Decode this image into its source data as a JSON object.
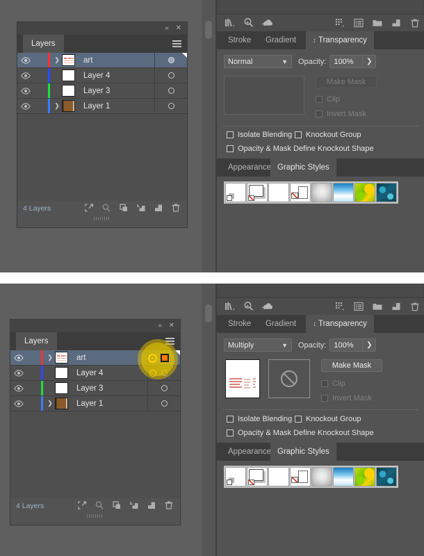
{
  "app": {
    "background_color": "#5f5f5f",
    "panel_bg": "#535353"
  },
  "top": {
    "layers_panel": {
      "title": "Layers",
      "collapse_label": "«",
      "close_label": "✕",
      "menu_icon": "hamburger-menu-icon",
      "columns": [
        "visibility",
        "lock",
        "color",
        "expand",
        "thumbnail",
        "name",
        "target"
      ],
      "rows": [
        {
          "name": "art",
          "visible": true,
          "selected": true,
          "color": "#ff2e2e",
          "has_disclosure": true,
          "thumb_type": "art",
          "target_filled": true
        },
        {
          "name": "Layer 4",
          "visible": true,
          "selected": false,
          "color": "#2b49ff",
          "has_disclosure": false,
          "thumb_type": "blank",
          "target_filled": false
        },
        {
          "name": "Layer 3",
          "visible": true,
          "selected": false,
          "color": "#1fe03c",
          "has_disclosure": false,
          "thumb_type": "blank",
          "target_filled": false
        },
        {
          "name": "Layer 1",
          "visible": true,
          "selected": false,
          "color": "#3a7bff",
          "has_disclosure": true,
          "thumb_type": "brown",
          "target_filled": false
        }
      ],
      "footer": {
        "count_label": "4 Layers",
        "buttons": [
          "locate-object-icon",
          "search-icon",
          "make-clipping-mask-icon",
          "create-new-sublayer-icon",
          "create-new-layer-icon",
          "delete-selection-icon"
        ]
      }
    },
    "right_panel": {
      "toolbar_icons_left": [
        "libraries-icon",
        "stock-search-icon",
        "cloud-upload-icon"
      ],
      "toolbar_icons_right": [
        "arrange-grid-icon",
        "properties-list-icon",
        "folder-icon",
        "new-layer-icon",
        "trash-icon"
      ],
      "tabs": [
        {
          "label": "Stroke",
          "active": false
        },
        {
          "label": "Gradient",
          "active": false
        },
        {
          "label": "Transparency",
          "active": true,
          "grip": "↕"
        }
      ],
      "blend_mode": "Normal",
      "opacity_label": "Opacity:",
      "opacity_value": "100%",
      "opacity_stepper_icon": "chevron-right-icon",
      "make_mask_label": "Make Mask",
      "clip_label": "Clip",
      "invert_mask_label": "Invert Mask",
      "clip_checked": false,
      "invert_checked": false,
      "isolate_blending_label": "Isolate Blending",
      "knockout_group_label": "Knockout Group",
      "opacity_mask_label": "Opacity & Mask Define Knockout Shape",
      "isolate_checked": false,
      "knockout_checked": false,
      "opacity_mask_checked": false,
      "artwork_thumb_visible": false,
      "mask_thumb_visible": false,
      "styles_tabs": [
        {
          "label": "Appearance",
          "active": false
        },
        {
          "label": "Graphic Styles",
          "active": true
        }
      ],
      "graphic_styles": [
        {
          "name": "default-drop-shadow-style",
          "kind": "white-with-shadow"
        },
        {
          "name": "none-style",
          "kind": "white-slash"
        },
        {
          "name": "plain-white-style",
          "kind": "white"
        },
        {
          "name": "split-none-style",
          "kind": "split-slash"
        },
        {
          "name": "grey-gradient-style",
          "kind": "grey-grad"
        },
        {
          "name": "blue-gradient-style",
          "kind": "blue-grad"
        },
        {
          "name": "green-yellow-pattern-style",
          "kind": "green-pattern"
        },
        {
          "name": "teal-swirl-pattern-style",
          "kind": "teal-pattern"
        }
      ]
    }
  },
  "bottom": {
    "layers_panel": {
      "title": "Layers",
      "collapse_label": "«",
      "close_label": "✕",
      "menu_icon": "hamburger-menu-icon",
      "rows": [
        {
          "name": "art",
          "visible": true,
          "selected": true,
          "color": "#ff2e2e",
          "has_disclosure": true,
          "thumb_type": "art",
          "target_filled": true
        },
        {
          "name": "Layer 4",
          "visible": true,
          "selected": false,
          "color": "#2b49ff",
          "has_disclosure": false,
          "thumb_type": "blank",
          "target_filled": false
        },
        {
          "name": "Layer 3",
          "visible": true,
          "selected": false,
          "color": "#1fe03c",
          "has_disclosure": false,
          "thumb_type": "blank",
          "target_filled": false
        },
        {
          "name": "Layer 1",
          "visible": true,
          "selected": false,
          "color": "#3a7bff",
          "has_disclosure": true,
          "thumb_type": "brown",
          "target_filled": false
        }
      ],
      "footer": {
        "count_label": "4 Layers",
        "buttons": [
          "locate-object-icon",
          "search-icon",
          "make-clipping-mask-icon",
          "create-new-sublayer-icon",
          "create-new-layer-icon",
          "delete-selection-icon"
        ]
      },
      "highlight": {
        "present": true,
        "color": "#d6b400",
        "target_ring_color": "#ffd400",
        "selection_square_color": "#ff7a00"
      }
    },
    "right_panel": {
      "toolbar_icons_left": [
        "libraries-icon",
        "stock-search-icon",
        "cloud-upload-icon"
      ],
      "toolbar_icons_right": [
        "arrange-grid-icon",
        "properties-list-icon",
        "folder-icon",
        "new-layer-icon",
        "trash-icon"
      ],
      "tabs": [
        {
          "label": "Stroke",
          "active": false
        },
        {
          "label": "Gradient",
          "active": false
        },
        {
          "label": "Transparency",
          "active": true,
          "grip": "↕"
        }
      ],
      "blend_mode": "Multiply",
      "opacity_label": "Opacity:",
      "opacity_value": "100%",
      "opacity_stepper_icon": "chevron-right-icon",
      "make_mask_label": "Make Mask",
      "clip_label": "Clip",
      "invert_mask_label": "Invert Mask",
      "clip_checked": false,
      "invert_checked": false,
      "isolate_blending_label": "Isolate Blending",
      "knockout_group_label": "Knockout Group",
      "opacity_mask_label": "Opacity & Mask Define Knockout Shape",
      "isolate_checked": false,
      "knockout_checked": false,
      "opacity_mask_checked": false,
      "artwork_thumb_visible": true,
      "mask_thumb_visible": true,
      "mask_thumb_icon": "no-mask-icon",
      "styles_tabs": [
        {
          "label": "Appearance",
          "active": false
        },
        {
          "label": "Graphic Styles",
          "active": true
        }
      ],
      "graphic_styles": [
        {
          "name": "default-drop-shadow-style",
          "kind": "white-with-shadow"
        },
        {
          "name": "none-style",
          "kind": "white-slash"
        },
        {
          "name": "plain-white-style",
          "kind": "white"
        },
        {
          "name": "split-none-style",
          "kind": "split-slash"
        },
        {
          "name": "grey-gradient-style",
          "kind": "grey-grad"
        },
        {
          "name": "blue-gradient-style",
          "kind": "blue-grad"
        },
        {
          "name": "green-yellow-pattern-style",
          "kind": "green-pattern"
        },
        {
          "name": "teal-swirl-pattern-style",
          "kind": "teal-pattern"
        }
      ]
    }
  }
}
